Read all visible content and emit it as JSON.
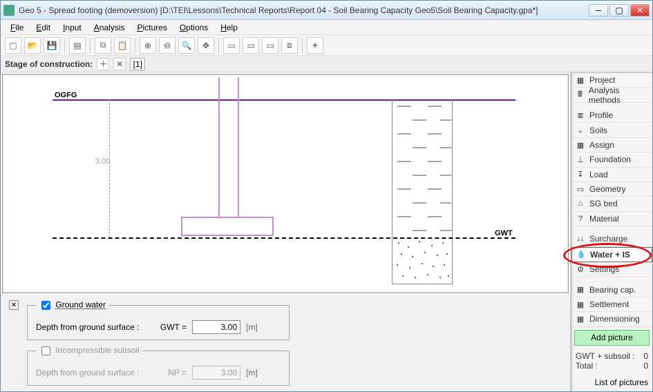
{
  "window": {
    "title": "Geo 5 - Spread footing (demoversion) [D:\\TEI\\Lessons\\Technical Reports\\Report 04 - Soil Bearing Capacity Geo5\\Soil Bearing Capacity.gpa*]"
  },
  "menu": {
    "file": "File",
    "edit": "Edit",
    "input": "Input",
    "analysis": "Analysis",
    "pictures": "Pictures",
    "options": "Options",
    "help": "Help"
  },
  "stagebar": {
    "label": "Stage of construction:",
    "tab1": "[1]"
  },
  "viewport": {
    "ogfg": "OGFG",
    "gwt": "GWT",
    "dim": "3.00"
  },
  "groundwater": {
    "legend": "Ground water",
    "depth_label": "Depth from ground surface :",
    "sym": "GWT =",
    "value": "3.00",
    "unit": "[m]"
  },
  "incomp": {
    "legend": "Incompressible subsoil",
    "depth_label": "Depth from ground surface :",
    "sym": "NP =",
    "value": "3.00",
    "unit": "[m]"
  },
  "right": {
    "project": "Project",
    "analysis_methods": "Analysis methods",
    "profile": "Profile",
    "soils": "Soils",
    "assign": "Assign",
    "foundation": "Foundation",
    "load": "Load",
    "geometry": "Geometry",
    "sgbed": "SG bed",
    "material": "Material",
    "surcharge": "Surcharge",
    "water_is": "Water + IS",
    "settings": "Settings",
    "bearing": "Bearing cap.",
    "settlement": "Settlement",
    "dimensioning": "Dimensioning",
    "add_picture": "Add picture",
    "gwt_subsoil_label": "GWT + subsoil :",
    "gwt_subsoil_val": "0",
    "total_label": "Total :",
    "total_val": "0",
    "list_pictures": "List of pictures"
  }
}
